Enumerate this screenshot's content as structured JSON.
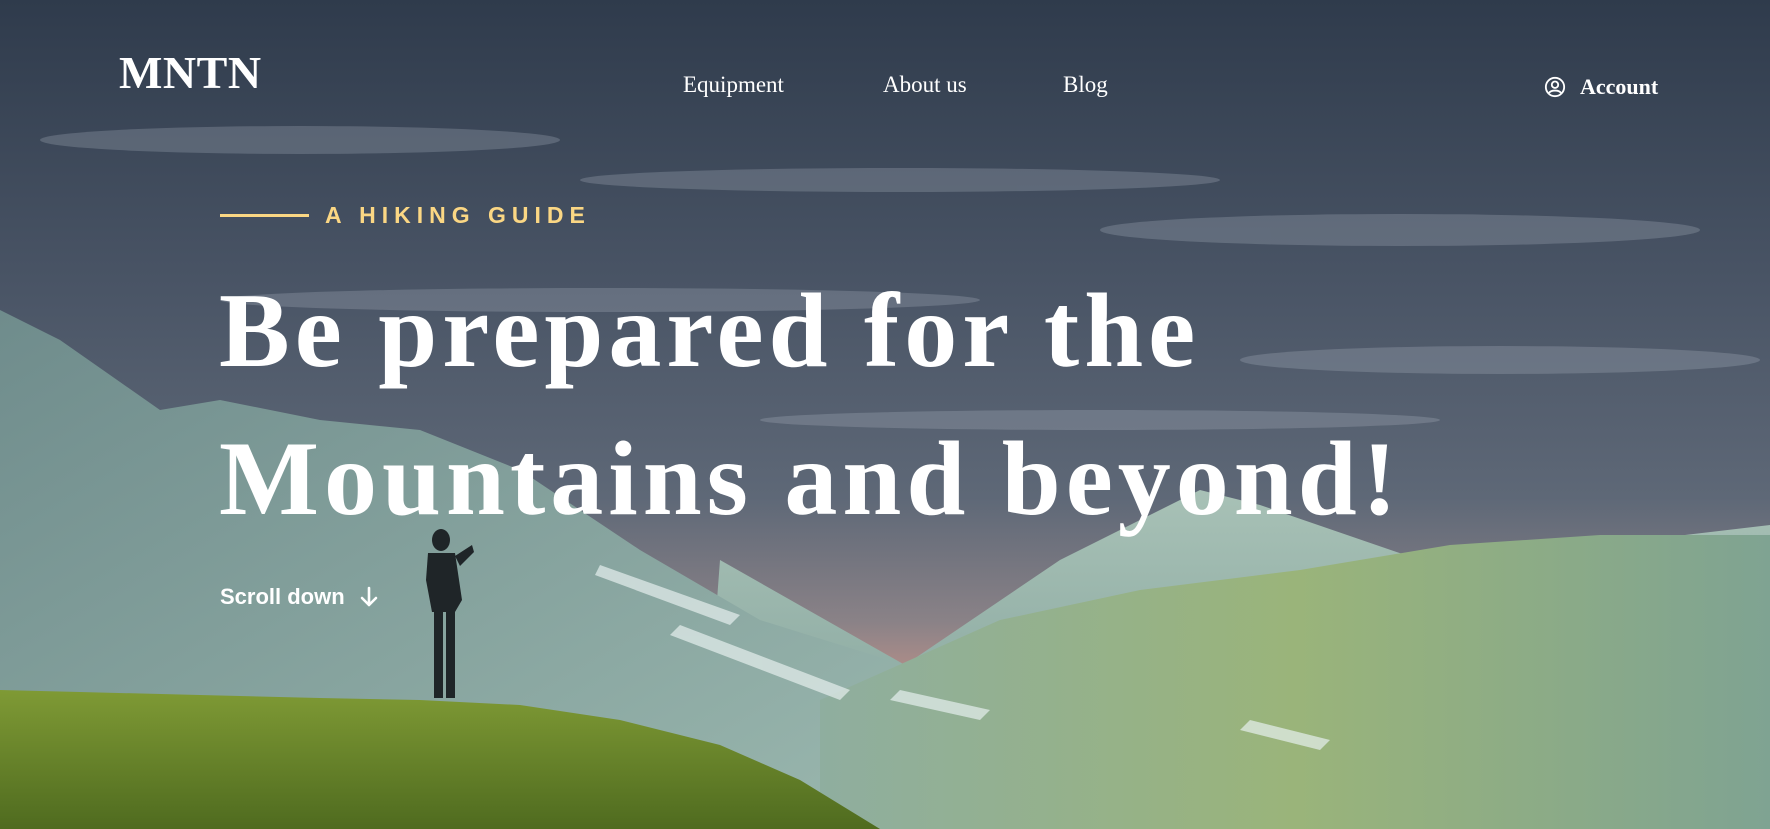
{
  "brand": {
    "logo": "MNTN"
  },
  "nav": {
    "links": [
      {
        "label": "Equipment"
      },
      {
        "label": "About us"
      },
      {
        "label": "Blog"
      }
    ],
    "account_label": "Account"
  },
  "hero": {
    "eyebrow": "A HIKING GUIDE",
    "headline_line1": "Be prepared for the",
    "headline_line2": "Mountains and beyond!",
    "scroll_label": "Scroll down"
  },
  "icons": {
    "account": "user-circle-icon",
    "scroll": "arrow-down-icon"
  },
  "colors": {
    "accent": "#FBD784",
    "text": "#FFFFFF",
    "sky": "#3B4757",
    "mountain": "#8FAFA6",
    "grass": "#6E8F2A"
  }
}
